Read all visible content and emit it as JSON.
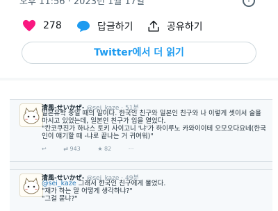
{
  "embed": {
    "date": "오후 11:56 · 2023년 1월 17일",
    "likes": "278",
    "reply_label": "답글하기",
    "share_label": "공유하기",
    "read_more": "Twitter에서 더 읽기"
  },
  "screenshot": {
    "tweet1": {
      "name": "清風-せいかぜ-",
      "handle": "@sei_kaze",
      "time": "51분",
      "line1": "일본유학 중일 때의 일이다. 한국인 친구와 일본인 친구와 나 이렇게 셋이서 술을",
      "line2": "마시고 있었는데, 일본인 친구가 입을 열었다.",
      "line3": "\"칸코쿠진가 하나스 토키 사이고니 '냐'가 하이루노 카와이이테 오모오다요네(한국",
      "line4": "인이 얘기할 때 -냐로 끝나는 거 귀여워)\"",
      "retweets": "943",
      "likes": "82"
    },
    "tweet2": {
      "name": "清風-せいかぜ-",
      "handle": "@sei_kaze",
      "time": "49분",
      "mention": "@sei_kaze",
      "line1_rest": " 그래서 한국인 친구에게 물었다.",
      "line2": "\"재가 하는 말 어떻게 생각하냐?\"",
      "line3": "\"그걸 묻냐?\""
    }
  }
}
